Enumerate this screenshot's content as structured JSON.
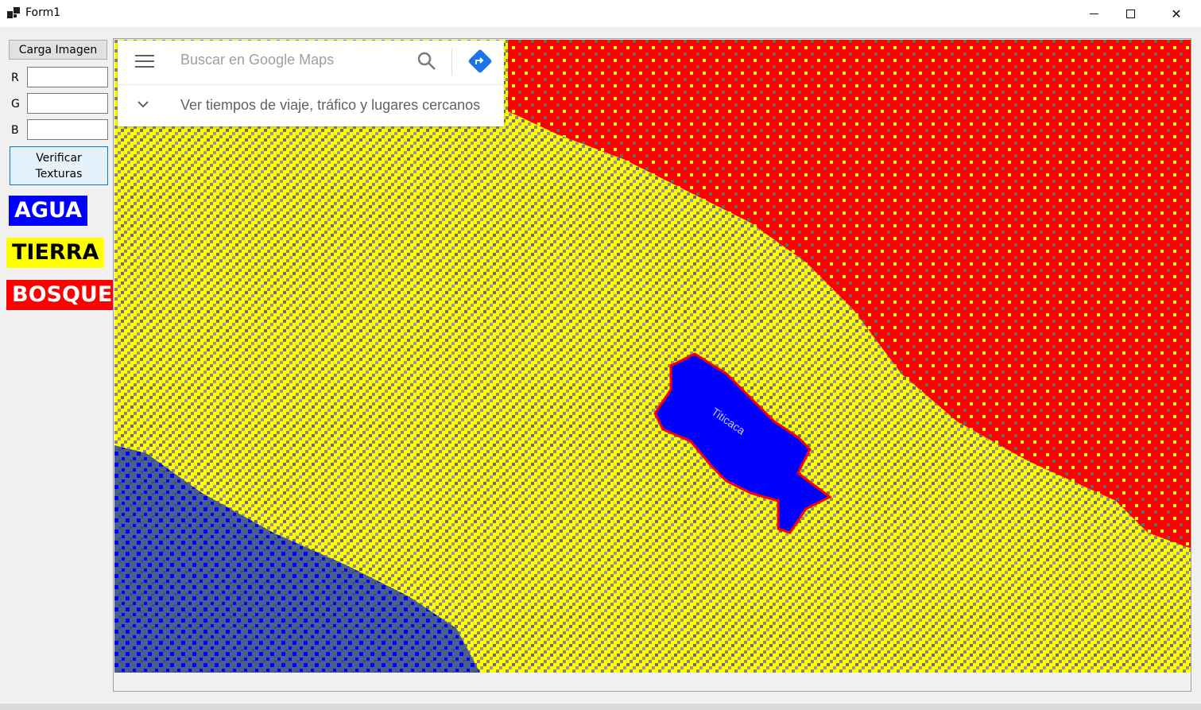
{
  "window": {
    "title": "Form1",
    "minimize_icon": "minimize-icon",
    "maximize_icon": "maximize-icon",
    "close_glyph": "✕"
  },
  "controls": {
    "load_button": "Carga Imagen",
    "r_label": "R",
    "g_label": "G",
    "b_label": "B",
    "r_value": "",
    "g_value": "",
    "b_value": "",
    "verify_button_line1": "Verificar",
    "verify_button_line2": "Texturas"
  },
  "legend": {
    "agua": "AGUA",
    "tierra": "TIERRA",
    "bosque": "BOSQUE",
    "colors": {
      "agua": "#0000ff",
      "tierra": "#ffff00",
      "bosque": "#ff0000"
    }
  },
  "map": {
    "search_placeholder": "Buscar en Google Maps",
    "nearby_text": "Ver tiempos de viaje, tráfico y lugares cercanos",
    "lake_label": "Titicaca",
    "icons": [
      "menu-icon",
      "search-icon",
      "directions-icon",
      "chevron-down-icon"
    ]
  }
}
